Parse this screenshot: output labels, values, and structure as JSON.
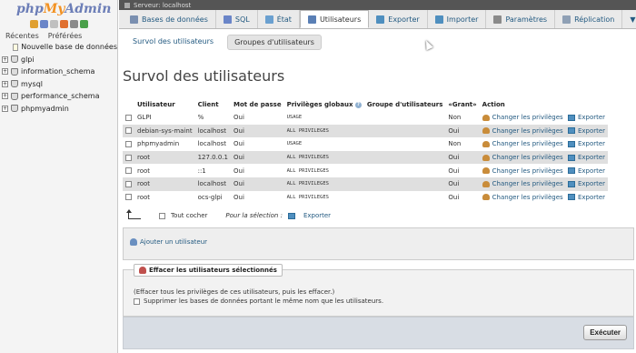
{
  "nav": {
    "logo": {
      "php": "php",
      "my": "My",
      "admin": "Admin"
    },
    "tabs": [
      "Récentes",
      "Préférées"
    ],
    "new_db": "Nouvelle base de données",
    "databases": [
      "glpi",
      "information_schema",
      "mysql",
      "performance_schema",
      "phpmyadmin"
    ]
  },
  "server_bar": {
    "label": "Serveur: localhost"
  },
  "top_tabs": [
    {
      "label": "Bases de données",
      "icon": "database-icon",
      "color": "#7a8fb0"
    },
    {
      "label": "SQL",
      "icon": "sql-icon",
      "color": "#6a85c8"
    },
    {
      "label": "État",
      "icon": "status-icon",
      "color": "#6aa0d0"
    },
    {
      "label": "Utilisateurs",
      "icon": "users-icon",
      "color": "#5a7fb5"
    },
    {
      "label": "Exporter",
      "icon": "export-icon",
      "color": "#4f8fbf"
    },
    {
      "label": "Importer",
      "icon": "import-icon",
      "color": "#4f8fbf"
    },
    {
      "label": "Paramètres",
      "icon": "wrench-icon",
      "color": "#8a8a8a"
    },
    {
      "label": "Réplication",
      "icon": "replication-icon",
      "color": "#8fa0b5"
    },
    {
      "label": "plus",
      "icon": "chevron-down-icon",
      "color": "#555"
    }
  ],
  "sub_tabs": [
    "Survol des utilisateurs",
    "Groupes d'utilisateurs"
  ],
  "page_title": "Survol des utilisateurs",
  "table": {
    "headers": [
      "Utilisateur",
      "Client",
      "Mot de passe",
      "Privilèges globaux",
      "Groupe d'utilisateurs",
      "«Grant»",
      "Action"
    ],
    "rows": [
      {
        "user": "GLPI",
        "host": "%",
        "password": "Oui",
        "privileges": "USAGE",
        "group": "",
        "grant": "Non",
        "edit": "Changer les privilèges",
        "export": "Exporter"
      },
      {
        "user": "debian-sys-maint",
        "host": "localhost",
        "password": "Oui",
        "privileges": "ALL PRIVILEGES",
        "group": "",
        "grant": "Oui",
        "edit": "Changer les privilèges",
        "export": "Exporter"
      },
      {
        "user": "phpmyadmin",
        "host": "localhost",
        "password": "Oui",
        "privileges": "USAGE",
        "group": "",
        "grant": "Non",
        "edit": "Changer les privilèges",
        "export": "Exporter"
      },
      {
        "user": "root",
        "host": "127.0.0.1",
        "password": "Oui",
        "privileges": "ALL PRIVILEGES",
        "group": "",
        "grant": "Oui",
        "edit": "Changer les privilèges",
        "export": "Exporter"
      },
      {
        "user": "root",
        "host": "::1",
        "password": "Oui",
        "privileges": "ALL PRIVILEGES",
        "group": "",
        "grant": "Oui",
        "edit": "Changer les privilèges",
        "export": "Exporter"
      },
      {
        "user": "root",
        "host": "localhost",
        "password": "Oui",
        "privileges": "ALL PRIVILEGES",
        "group": "",
        "grant": "Oui",
        "edit": "Changer les privilèges",
        "export": "Exporter"
      },
      {
        "user": "root",
        "host": "ocs-glpi",
        "password": "Oui",
        "privileges": "ALL PRIVILEGES",
        "group": "",
        "grant": "Oui",
        "edit": "Changer les privilèges",
        "export": "Exporter"
      }
    ]
  },
  "bulk": {
    "check_all": "Tout cocher",
    "selection_label": "Pour la sélection :",
    "export": "Exporter"
  },
  "add_user": "Ajouter un utilisateur",
  "delete_panel": {
    "legend": "Effacer les utilisateurs sélectionnés",
    "note": "(Effacer tous les privilèges de ces utilisateurs, puis les effacer.)",
    "option": "Supprimer les bases de données portant le même nom que les utilisateurs."
  },
  "execute_button": "Exécuter"
}
